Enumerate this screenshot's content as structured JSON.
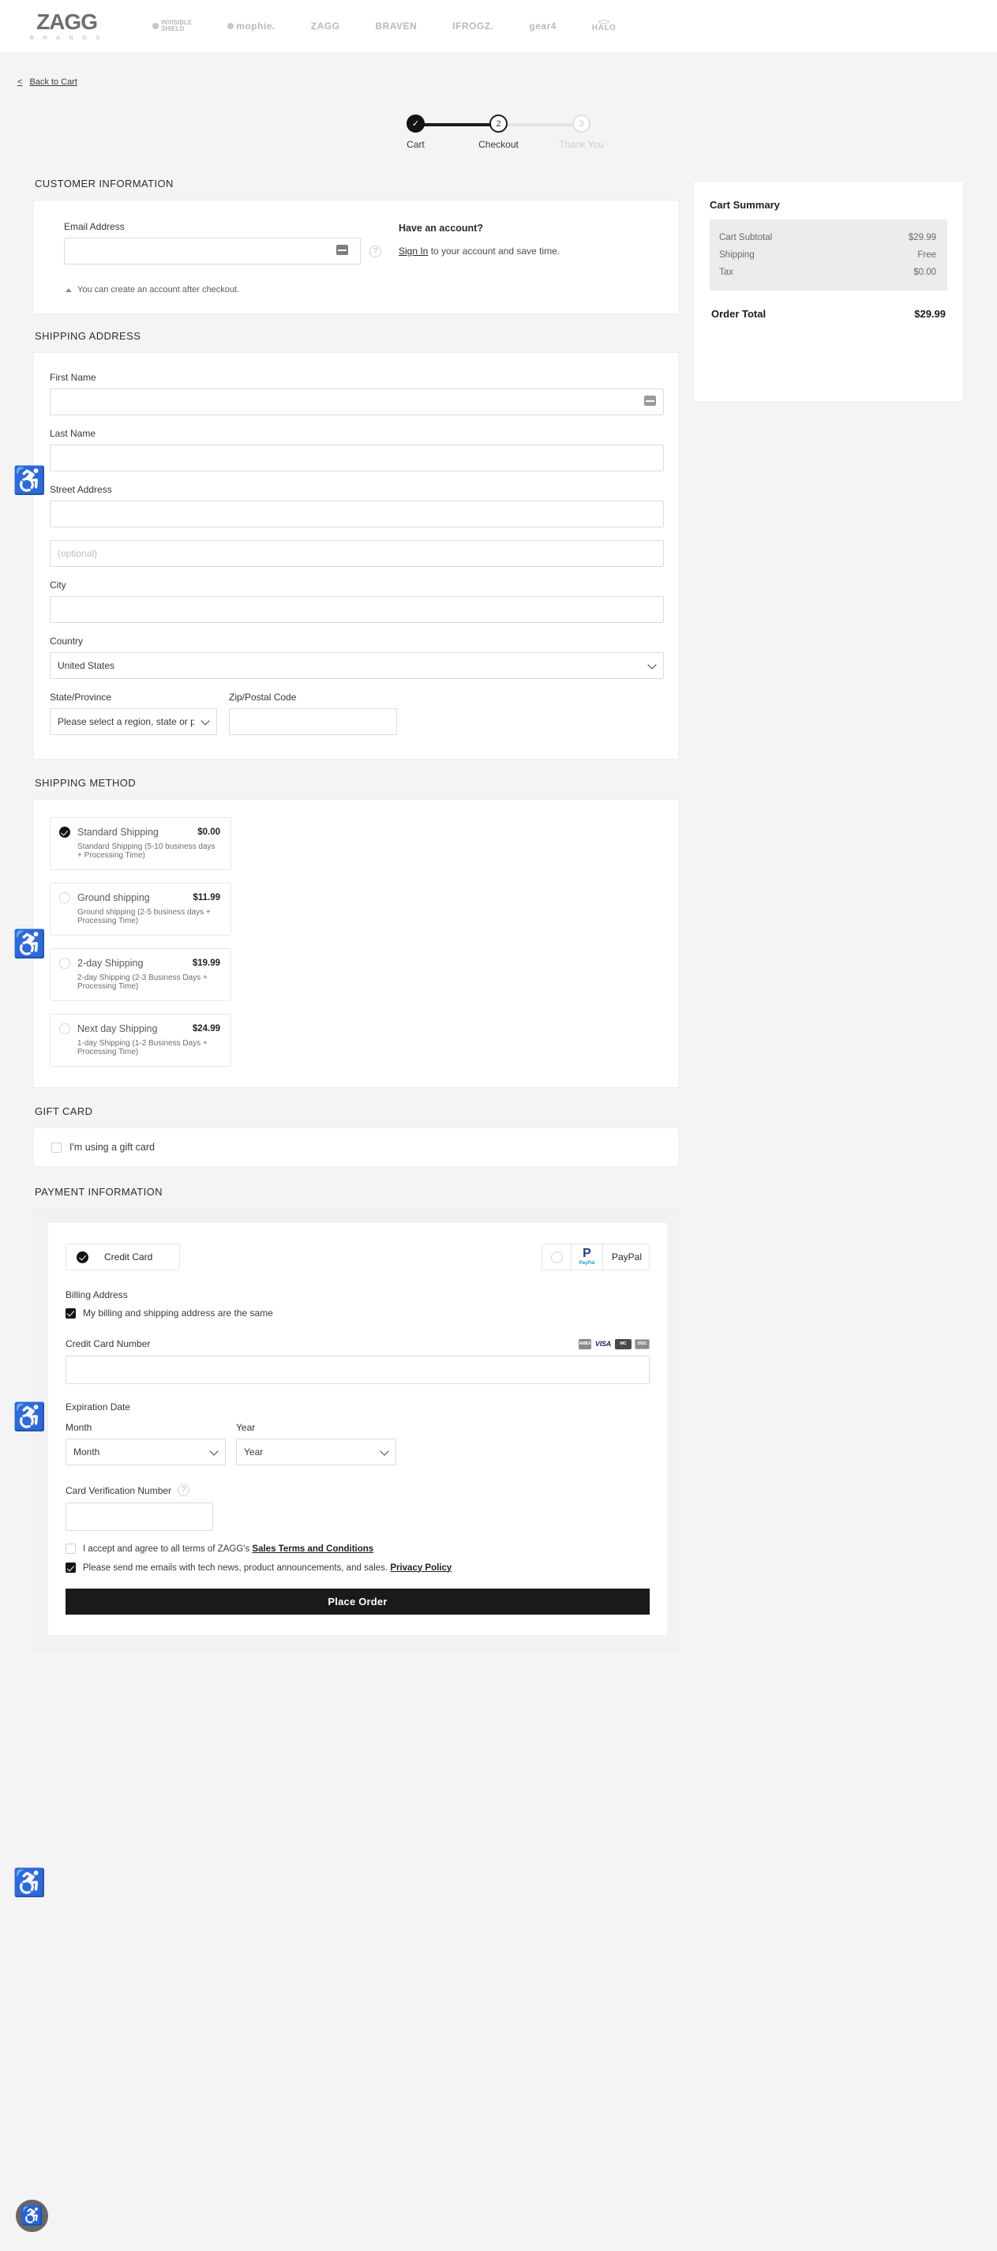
{
  "brandbar": {
    "primary_logo": {
      "mark": "ZAGG",
      "sub": "B R A N D S"
    },
    "brands": [
      {
        "name": "INVISIBLE SHIELD",
        "line1": "INVISIBLE",
        "line2": "SHIELD",
        "icon": "shield-icon"
      },
      {
        "name": "mophie",
        "label": "mophie.",
        "icon": "mophie-dot-icon"
      },
      {
        "name": "ZAGG",
        "label": "ZAGG"
      },
      {
        "name": "BRAVEN",
        "label": "BRAVEN"
      },
      {
        "name": "IFROGZ",
        "label": "IFROGZ."
      },
      {
        "name": "gear4",
        "label": "gear4"
      },
      {
        "name": "HALO",
        "label": "HALO"
      }
    ]
  },
  "back": {
    "label": "Back to Cart",
    "chevron": "<"
  },
  "stepper": {
    "steps": [
      {
        "label": "Cart",
        "badge": "✓",
        "state": "done"
      },
      {
        "label": "Checkout",
        "badge": "2",
        "state": "current"
      },
      {
        "label": "Thank You",
        "badge": "3",
        "state": "todo"
      }
    ]
  },
  "customer": {
    "section_title": "CUSTOMER INFORMATION",
    "email_label": "Email Address",
    "email_value": "",
    "email_placeholder": "",
    "help_icon": "?",
    "have_account_title": "Have an account?",
    "signin_link": "Sign In",
    "signin_rest": " to your account and save time.",
    "note": "You can create an account after checkout."
  },
  "shipping_address": {
    "section_title": "SHIPPING ADDRESS",
    "first_name_label": "First Name",
    "first_name_value": "",
    "last_name_label": "Last Name",
    "last_name_value": "",
    "street_label": "Street Address",
    "street_value": "",
    "street2_placeholder": "(optional)",
    "street2_value": "",
    "city_label": "City",
    "city_value": "",
    "country_label": "Country",
    "country_value": "United States",
    "state_label": "State/Province",
    "state_value": "Please select a region, state or province.",
    "zip_label": "Zip/Postal Code",
    "zip_value": ""
  },
  "shipping_method": {
    "section_title": "SHIPPING METHOD",
    "options": [
      {
        "name": "Standard Shipping",
        "price": "$0.00",
        "desc": "Standard Shipping (5-10 business days + Processing Time)",
        "selected": true
      },
      {
        "name": "Ground shipping",
        "price": "$11.99",
        "desc": "Ground shipping (2-5 business days + Processing Time)",
        "selected": false
      },
      {
        "name": "2-day Shipping",
        "price": "$19.99",
        "desc": "2-day Shipping (2-3 Business Days + Processing Time)",
        "selected": false
      },
      {
        "name": "Next day Shipping",
        "price": "$24.99",
        "desc": "1-day Shipping (1-2 Business Days + Processing Time)",
        "selected": false
      }
    ]
  },
  "gift_card": {
    "section_title": "GIFT CARD",
    "checkbox_label": "I'm using a gift card",
    "checked": false
  },
  "payment": {
    "section_title": "PAYMENT INFORMATION",
    "method_credit_card": "Credit Card",
    "method_paypal": "PayPal",
    "paypal_logo_mark": "P",
    "paypal_logo_text": "PayPal",
    "selected_method": "Credit Card",
    "billing_address_label": "Billing Address",
    "billing_same_label": "My billing and shipping address are the same",
    "billing_same_checked": true,
    "cc_number_label": "Credit Card Number",
    "cc_number_value": "",
    "card_brands": [
      "AMERICAN EXPRESS",
      "VISA",
      "MasterCard",
      "DISCOVER"
    ],
    "card_brand_short": [
      "AMEX",
      "VISA",
      "MC",
      "DISCOVER"
    ],
    "expiration_label": "Expiration Date",
    "month_label": "Month",
    "month_value": "Month",
    "year_label": "Year",
    "year_value": "Year",
    "cvv_label": "Card Verification Number",
    "cvv_help_icon": "?",
    "cvv_value": "",
    "terms_pre": "I accept and agree to all terms of ZAGG's ",
    "terms_link": "Sales Terms and Conditions",
    "terms_checked": false,
    "emails_pre": "Please send me emails with tech news, product announcements, and sales. ",
    "emails_link": "Privacy Policy",
    "emails_checked": true,
    "place_order_label": "Place Order"
  },
  "cart_summary": {
    "title": "Cart Summary",
    "lines": [
      {
        "label": "Cart Subtotal",
        "value": "$29.99"
      },
      {
        "label": "Shipping",
        "value": "Free"
      },
      {
        "label": "Tax",
        "value": "$0.00"
      }
    ],
    "total_label": "Order Total",
    "total_value": "$29.99"
  },
  "accessibility": {
    "icon": "♿",
    "name": "accessibility-widget"
  },
  "colors": {
    "accent": "#1a1a1a",
    "page_bg": "#f4f4f4",
    "card_bg": "#ffffff",
    "summary_rows_bg": "#ececec"
  }
}
